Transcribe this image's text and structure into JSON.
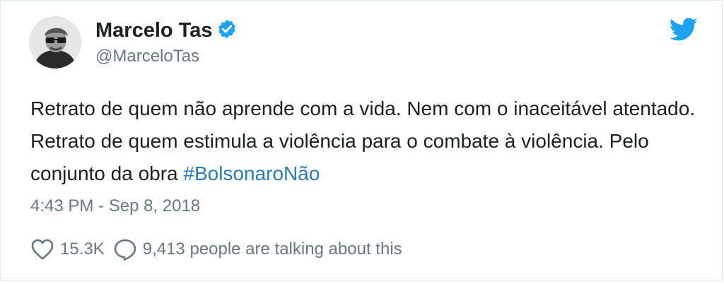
{
  "author": {
    "name": "Marcelo Tas",
    "handle": "@MarceloTas"
  },
  "tweet": {
    "text": "Retrato de quem não aprende com a vida. Nem com o inaceitável atentado. Retrato de quem estimula a violência para o combate à violência. Pelo conjunto da obra ",
    "hashtag": "#BolsonaroNão",
    "timestamp": "4:43 PM - Sep 8, 2018"
  },
  "actions": {
    "likes": "15.3K",
    "talking": "9,413 people are talking about this"
  },
  "icons": {
    "like": "heart-icon",
    "reply": "speech-bubble-icon",
    "brand": "twitter-bird-icon",
    "verified": "verified-badge-icon"
  },
  "colors": {
    "brand": "#1da1f2",
    "hashtag": "#2b7bb9",
    "secondary_text": "#697882",
    "primary_text": "#1c2022"
  }
}
